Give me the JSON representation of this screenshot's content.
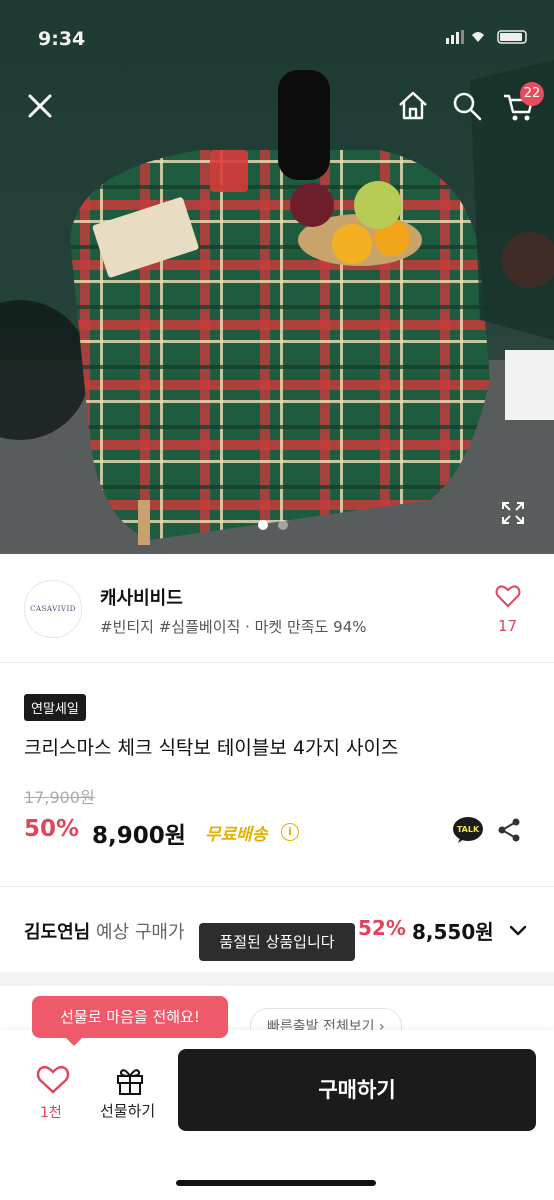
{
  "status_bar": {
    "time": "9:34"
  },
  "product_image": {
    "cart_badge": "22",
    "slide_count": 2,
    "active_slide": 1,
    "icons": [
      "close-icon",
      "home-icon",
      "search-icon",
      "cart-icon",
      "expand-icon"
    ]
  },
  "seller": {
    "logo_text": "CASAVIVID",
    "name": "캐사비비드",
    "tags": "#빈티지 #심플베이직 · 마켓 만족도 94%",
    "likes": "17"
  },
  "product": {
    "badge": "연말세일",
    "title": "크리스마스 체크 식탁보 테이블보 4가지 사이즈",
    "original_price": "17,900원",
    "discount": "50%",
    "price": "8,900원",
    "shipping": "무료배송",
    "talk_label": "TALK"
  },
  "member_price": {
    "name": "김도연님",
    "label": "예상 구매가",
    "discount": "52%",
    "price": "8,550원"
  },
  "toast": "품절된 상품입니다",
  "quick_shipping": "빠른출발 전체보기 ›",
  "bottom_bar": {
    "gift_tooltip": "선물로 마음을 전해요!",
    "likes": "1천",
    "gift_label": "선물하기",
    "buy_label": "구매하기"
  },
  "colors": {
    "accent": "#e0455b",
    "shipping": "#e4b100",
    "dark": "#1b1b1b"
  }
}
